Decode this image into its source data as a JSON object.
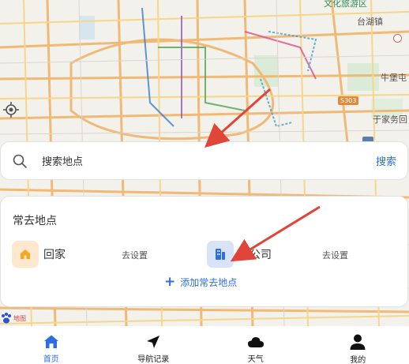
{
  "map": {
    "labels": {
      "top_right": "文化旅游区",
      "tai_hu_zhen": "台湖镇",
      "niu_bao_tun": "牛堡屯",
      "yu_jia_wu": "于家务回",
      "road_code": "S303"
    },
    "logo_text": "地图"
  },
  "search": {
    "placeholder": "搜索地点",
    "button_label": "搜索"
  },
  "places": {
    "title": "常去地点",
    "home": {
      "name": "回家",
      "action": "去设置"
    },
    "company": {
      "name": "去公司",
      "action": "去设置"
    },
    "add_label": "添加常去地点"
  },
  "tabs": [
    {
      "label": "首页",
      "icon": "home-icon",
      "active": true
    },
    {
      "label": "导航记录",
      "icon": "navigation-icon",
      "active": false
    },
    {
      "label": "天气",
      "icon": "cloud-icon",
      "active": false
    },
    {
      "label": "我的",
      "icon": "person-icon",
      "active": false
    }
  ],
  "colors": {
    "accent": "#2b6de5",
    "annotation_arrow": "#e0453a",
    "home_icon": "#f5a623",
    "company_icon": "#2b6de5"
  }
}
